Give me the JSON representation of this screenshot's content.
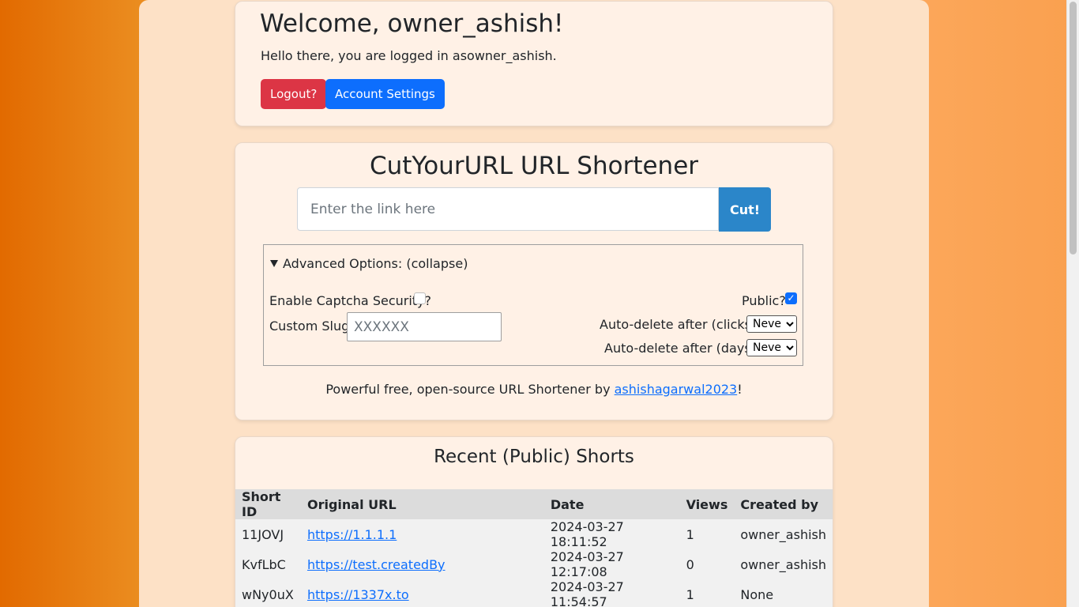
{
  "welcome": {
    "title": "Welcome, owner_ashish!",
    "message": "Hello there, you are logged in asowner_ashish.",
    "logout_label": "Logout?",
    "settings_label": "Account Settings"
  },
  "shortener": {
    "title": "CutYourURL URL Shortener",
    "input_placeholder": "Enter the link here",
    "cut_label": "Cut!",
    "advanced": {
      "summary": "Advanced Options: (collapse)",
      "captcha_label": "Enable Captcha Security?",
      "captcha_checked": false,
      "public_label": "Public?",
      "public_checked": true,
      "slug_label": "Custom Slug:",
      "slug_placeholder": "XXXXXX",
      "clicks_label": "Auto-delete after (clicks):",
      "clicks_value": "Never",
      "days_label": "Auto-delete after (days):",
      "days_value": "Never"
    },
    "footer_text": "Powerful free, open-source URL Shortener by",
    "footer_link": "ashishagarwal2023",
    "footer_suffix": "!"
  },
  "recent": {
    "title": "Recent (Public) Shorts",
    "columns": [
      "Short ID",
      "Original URL",
      "Date",
      "Views",
      "Created by"
    ],
    "rows": [
      {
        "id": "11JOVJ",
        "url": "https://1.1.1.1",
        "date": "2024-03-27 18:11:52",
        "views": "1",
        "created_by": "owner_ashish"
      },
      {
        "id": "KvfLbC",
        "url": "https://test.createdBy",
        "date": "2024-03-27 12:17:08",
        "views": "0",
        "created_by": "owner_ashish"
      },
      {
        "id": "wNy0uX",
        "url": "https://1337x.to",
        "date": "2024-03-27 11:54:57",
        "views": "1",
        "created_by": "None"
      }
    ]
  }
}
